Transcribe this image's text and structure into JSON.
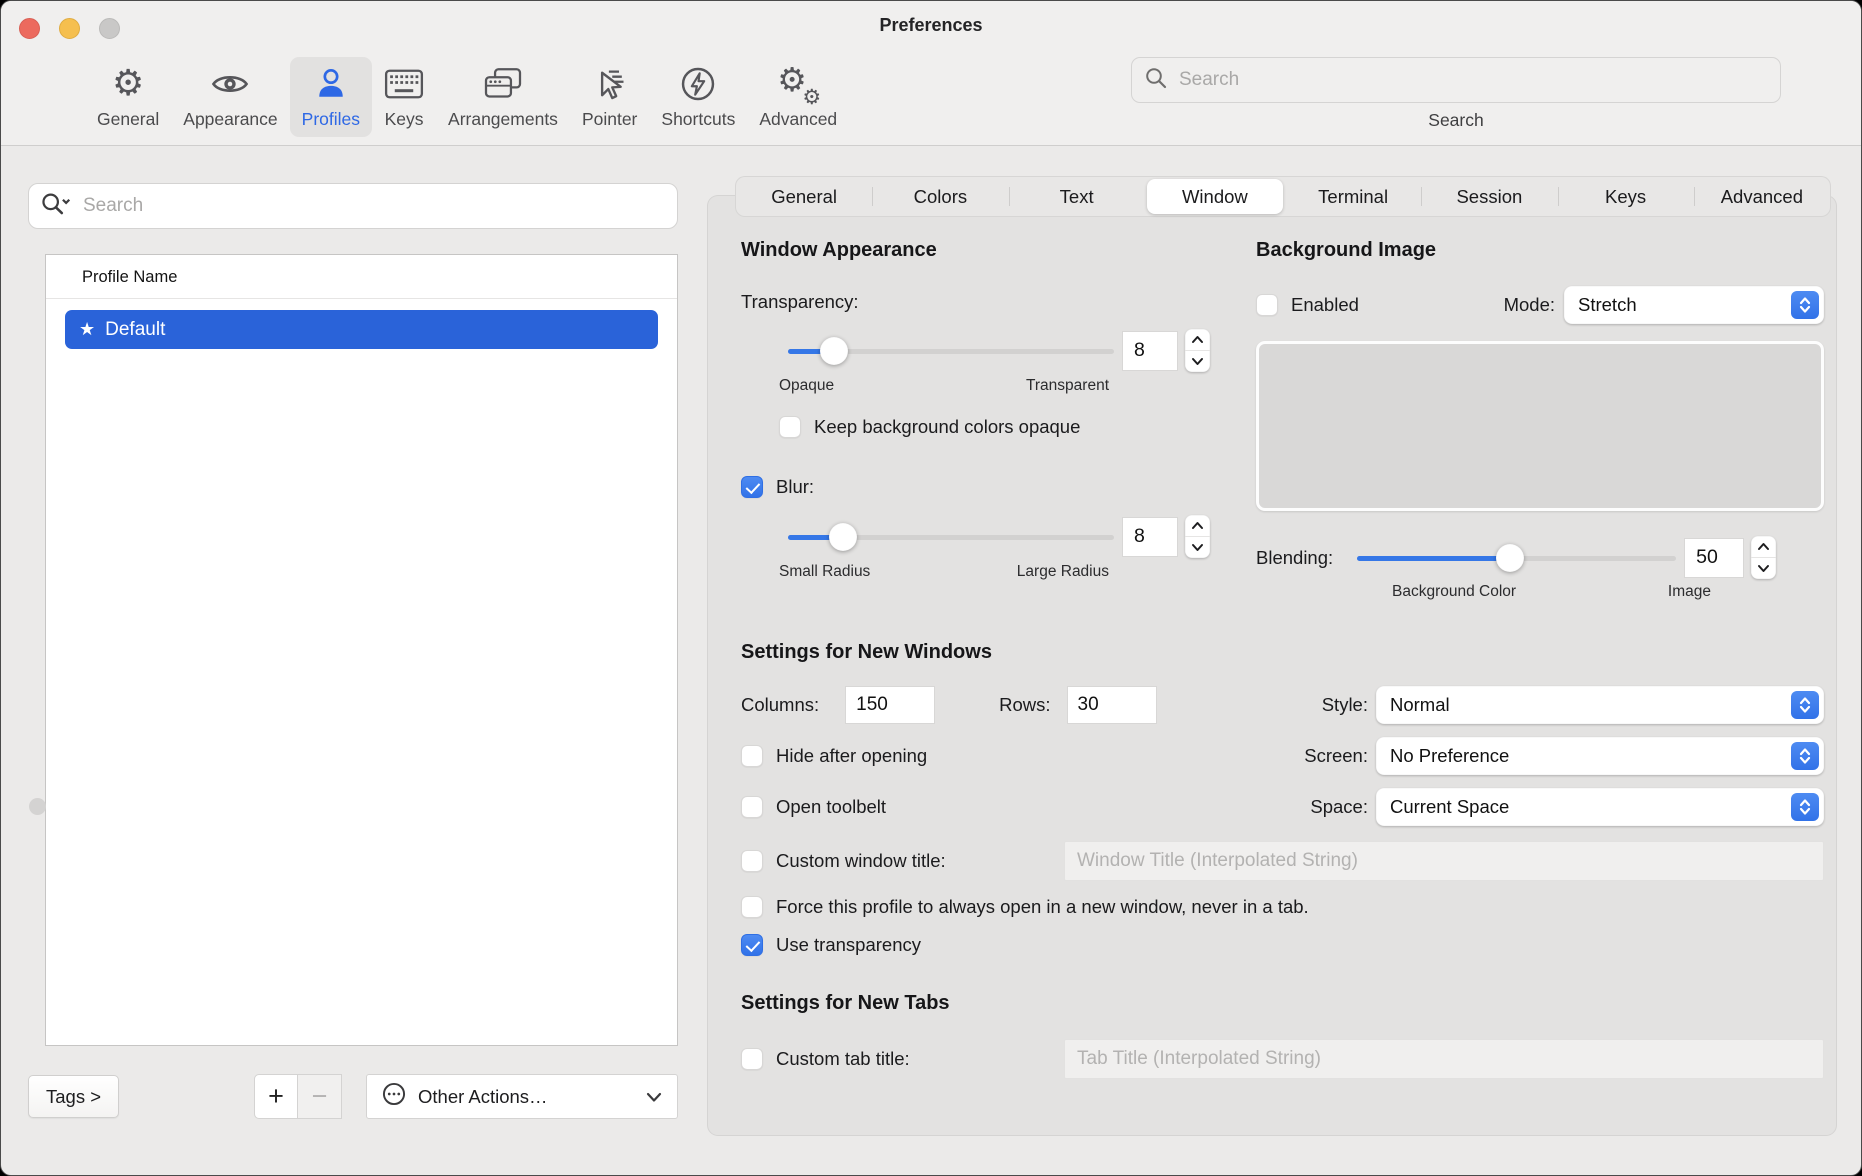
{
  "window": {
    "title": "Preferences"
  },
  "toolbar": {
    "items": [
      {
        "label": "General",
        "icon": "gear-icon"
      },
      {
        "label": "Appearance",
        "icon": "eye-icon"
      },
      {
        "label": "Profiles",
        "icon": "person-icon",
        "active": true
      },
      {
        "label": "Keys",
        "icon": "keyboard-icon"
      },
      {
        "label": "Arrangements",
        "icon": "windows-icon"
      },
      {
        "label": "Pointer",
        "icon": "cursor-icon"
      },
      {
        "label": "Shortcuts",
        "icon": "lightning-circle-icon"
      },
      {
        "label": "Advanced",
        "icon": "double-gear-icon"
      }
    ],
    "search": {
      "placeholder": "Search",
      "label": "Search"
    }
  },
  "sidebar": {
    "search_placeholder": "Search",
    "list_header": "Profile Name",
    "profile": {
      "star": "★",
      "name": "Default",
      "selected": true
    },
    "tags_button": "Tags >",
    "add_button": "+",
    "remove_button": "−",
    "other_actions": "Other Actions…"
  },
  "tabs": {
    "active": "Window",
    "items": [
      "General",
      "Colors",
      "Text",
      "Window",
      "Terminal",
      "Session",
      "Keys",
      "Advanced"
    ]
  },
  "panel": {
    "window_appearance": {
      "heading": "Window Appearance",
      "transparency": {
        "label": "Transparency:",
        "value": "8",
        "min_label": "Opaque",
        "max_label": "Transparent",
        "percent": 14
      },
      "keep_bg_opaque": {
        "label": "Keep background colors opaque",
        "checked": false
      },
      "blur": {
        "label": "Blur:",
        "checked": true,
        "value": "8",
        "min_label": "Small Radius",
        "max_label": "Large Radius",
        "percent": 17
      }
    },
    "background_image": {
      "heading": "Background Image",
      "enabled": {
        "label": "Enabled",
        "checked": false
      },
      "mode": {
        "label": "Mode:",
        "value": "Stretch"
      },
      "blending": {
        "label": "Blending:",
        "value": "50",
        "min_label": "Background Color",
        "max_label": "Image",
        "percent": 48
      }
    },
    "new_windows": {
      "heading": "Settings for New Windows",
      "columns": {
        "label": "Columns:",
        "value": "150"
      },
      "rows": {
        "label": "Rows:",
        "value": "30"
      },
      "style": {
        "label": "Style:",
        "value": "Normal"
      },
      "screen": {
        "label": "Screen:",
        "value": "No Preference"
      },
      "space": {
        "label": "Space:",
        "value": "Current Space"
      },
      "hide_after_opening": {
        "label": "Hide after opening",
        "checked": false
      },
      "open_toolbelt": {
        "label": "Open toolbelt",
        "checked": false
      },
      "custom_window_title": {
        "label": "Custom window title:",
        "checked": false,
        "placeholder": "Window Title (Interpolated String)"
      },
      "force_new_window": {
        "label": "Force this profile to always open in a new window, never in a tab.",
        "checked": false
      },
      "use_transparency": {
        "label": "Use transparency",
        "checked": true
      }
    },
    "new_tabs": {
      "heading": "Settings for New Tabs",
      "custom_tab_title": {
        "label": "Custom tab title:",
        "checked": false,
        "placeholder": "Tab Title (Interpolated String)"
      }
    }
  },
  "colors": {
    "accent_blue": "#3478f6",
    "selection_blue": "#2a63d9",
    "toolbar_active_blue": "#2e68e5"
  }
}
